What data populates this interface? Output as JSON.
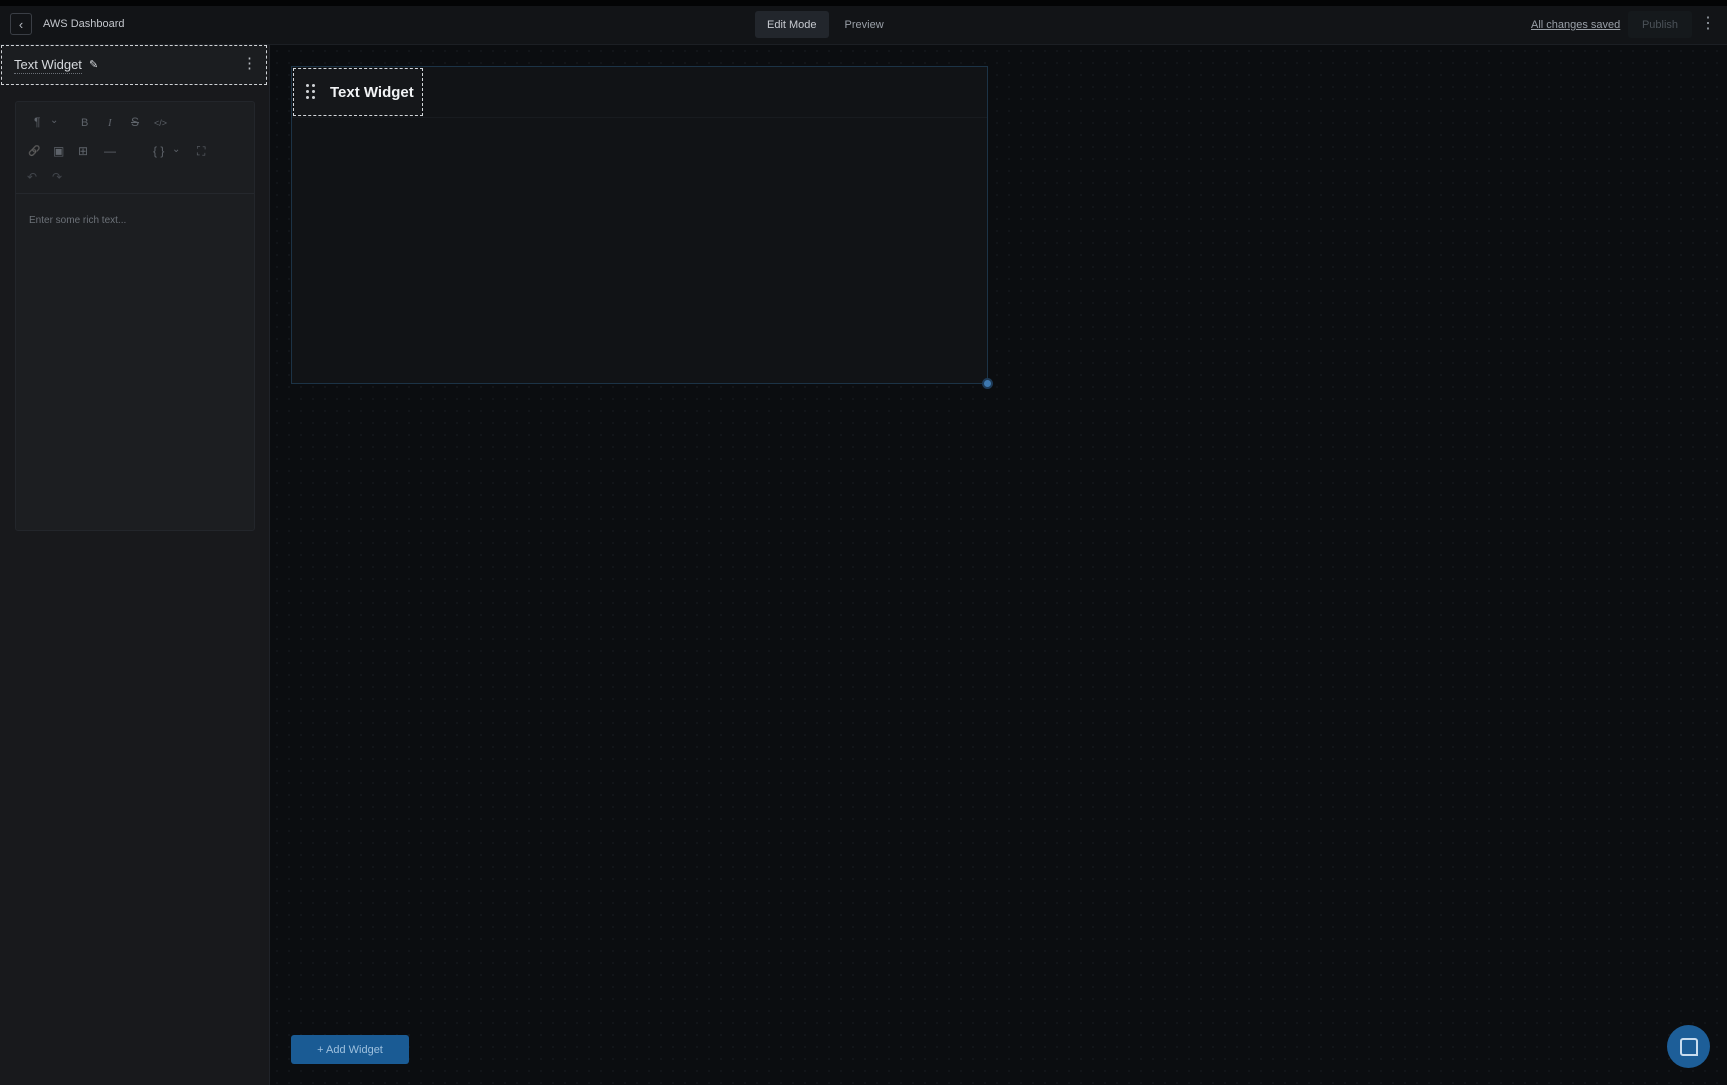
{
  "header": {
    "app_title": "AWS Dashboard",
    "back_icon": "‹",
    "tabs": [
      {
        "label": "Edit Mode",
        "active": true
      },
      {
        "label": "Preview",
        "active": false
      }
    ],
    "saved_status": "All changes saved",
    "publish_label": "Publish",
    "menu_icon": "⋮"
  },
  "sidebar": {
    "panel_title": "Text Widget",
    "pencil_icon": "✎",
    "menu_icon": "⋮",
    "toolbar": {
      "paragraph": "¶",
      "bold": "B",
      "italic": "I",
      "strike": "S",
      "code": "</>",
      "link": "🔗",
      "image": "▣",
      "table": "⊞",
      "hr": "—",
      "variables": "{ }",
      "fullscreen": "⛶",
      "undo": "↶",
      "redo": "↷",
      "chevron": "⌄"
    },
    "editor_placeholder": "Enter some rich text..."
  },
  "canvas": {
    "widget_title": "Text Widget",
    "add_widget_label": "+ Add Widget"
  },
  "colors": {
    "accent": "#1a5b94",
    "resize_handle": "#3d78b0",
    "background": "#0b0d10"
  }
}
